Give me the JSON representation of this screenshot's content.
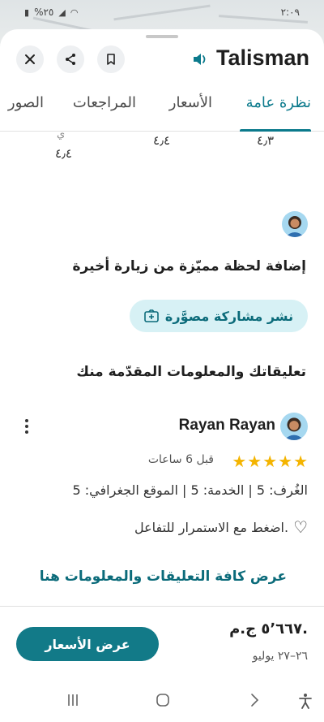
{
  "status_bar": {
    "time": "٢:٠٩",
    "battery": "%٢٥"
  },
  "header": {
    "title": "Talisman"
  },
  "tabs": [
    {
      "label": "نظرة عامة",
      "active": true
    },
    {
      "label": "الأسعار",
      "active": false
    },
    {
      "label": "المراجعات",
      "active": false
    },
    {
      "label": "الصور",
      "active": false
    }
  ],
  "ratings_strip": {
    "value_1": "٤٫٣",
    "value_2": "٤٫٤",
    "value_3": "٤٫٤",
    "partial_label": "ي"
  },
  "add_moment": {
    "title": "إضافة لحظة مميّزة من زيارة أخيرة",
    "post_photo_label": "نشر مشاركة مصوَّرة"
  },
  "your_review": {
    "title": "تعليقاتك والمعلومات المقدّمة منك",
    "reviewer_name": "Rayan Rayan",
    "rating_stars": 5,
    "time": "قبل 6 ساعات",
    "ratings_line": "الغُرف: 5 | الخدمة: 5 | الموقع الجغرافي: 5",
    "like_prompt": "اضغط مع الاستمرار للتفاعل.",
    "view_all_label": "عرض كافة التعليقات والمعلومات هنا"
  },
  "footer": {
    "price": "٥٬٦٦٧ ج.م.",
    "dates": "٢٦–٢٧ يوليو",
    "view_prices_label": "عرض الأسعار"
  },
  "colors": {
    "accent": "#0b7a8c",
    "button": "#127a88",
    "chip_bg": "#d7f1f5",
    "star": "#f4b400"
  }
}
